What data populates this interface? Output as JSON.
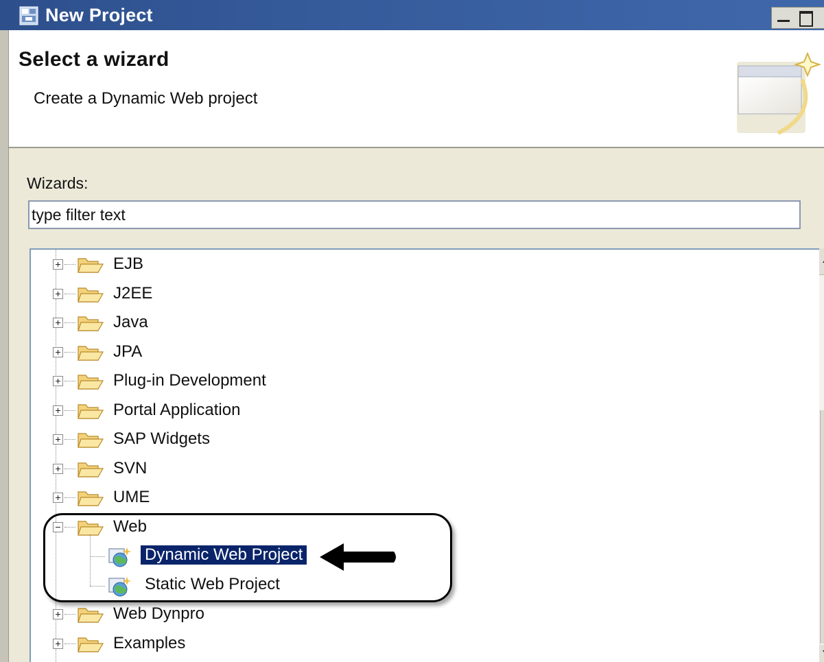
{
  "window": {
    "title": "New Project"
  },
  "header": {
    "heading": "Select a wizard",
    "subtitle": "Create a Dynamic Web project"
  },
  "wizards": {
    "label": "Wizards:",
    "filter_value": "type filter text"
  },
  "tree": {
    "categories": [
      {
        "label": "EJB",
        "expanded": false
      },
      {
        "label": "J2EE",
        "expanded": false
      },
      {
        "label": "Java",
        "expanded": false
      },
      {
        "label": "JPA",
        "expanded": false
      },
      {
        "label": "Plug-in Development",
        "expanded": false
      },
      {
        "label": "Portal Application",
        "expanded": false
      },
      {
        "label": "SAP Widgets",
        "expanded": false
      },
      {
        "label": "SVN",
        "expanded": false
      },
      {
        "label": "UME",
        "expanded": false
      },
      {
        "label": "Web",
        "expanded": true
      },
      {
        "label": "Web Dynpro",
        "expanded": false
      },
      {
        "label": "Examples",
        "expanded": false
      }
    ],
    "web_children": [
      {
        "label": "Dynamic Web Project",
        "selected": true
      },
      {
        "label": "Static Web Project",
        "selected": false
      }
    ]
  },
  "colors": {
    "titlebar": "#2d4f8c",
    "selection": "#0a246a",
    "dialog_background": "#ece9d8",
    "folder": "#f5c86a"
  }
}
